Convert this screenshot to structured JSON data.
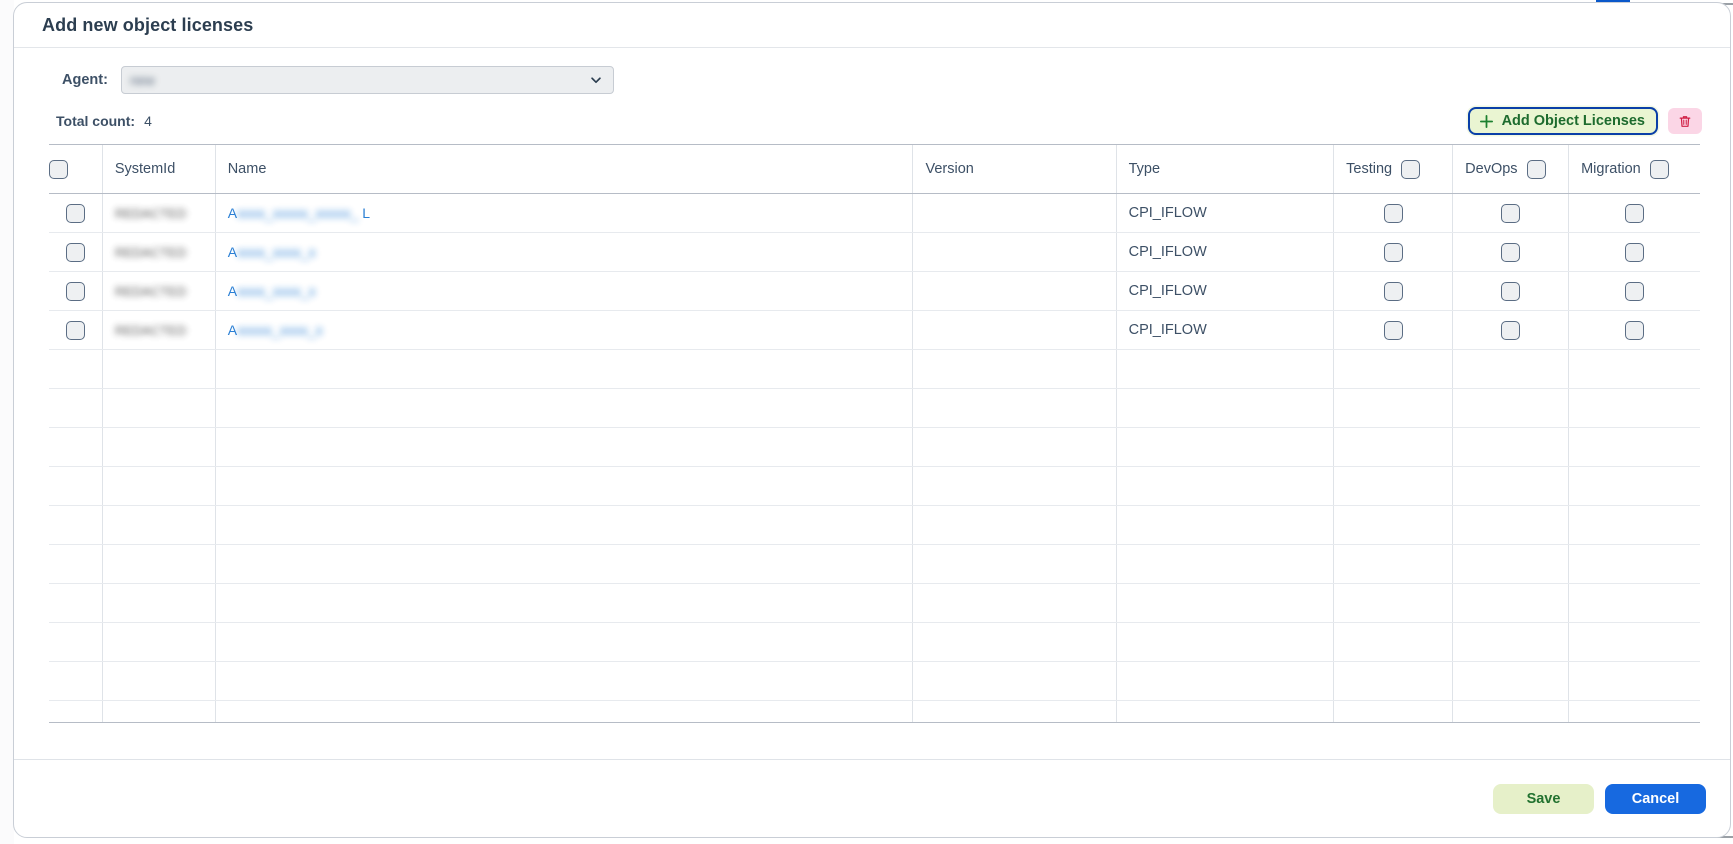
{
  "dialog": {
    "title": "Add new object licenses"
  },
  "agent": {
    "label": "Agent:",
    "selected_value": "new",
    "chevron_icon": "chevron-down-icon"
  },
  "summary": {
    "count_label": "Total count:",
    "count_value": "4"
  },
  "toolbar": {
    "add_label": "Add Object Licenses",
    "add_icon": "plus-icon",
    "delete_icon": "trash-icon",
    "accent_border": "#0a3fa8",
    "add_bg": "#eaf5d2",
    "add_text_color": "#1d6b2e",
    "delete_bg": "#fbd6e6",
    "delete_icon_color": "#d01f45"
  },
  "table": {
    "columns": [
      {
        "key": "select",
        "label": "",
        "has_header_checkbox": true
      },
      {
        "key": "systemId",
        "label": "SystemId",
        "has_header_checkbox": false
      },
      {
        "key": "name",
        "label": "Name",
        "has_header_checkbox": false
      },
      {
        "key": "version",
        "label": "Version",
        "has_header_checkbox": false
      },
      {
        "key": "type",
        "label": "Type",
        "has_header_checkbox": false
      },
      {
        "key": "testing",
        "label": "Testing",
        "has_header_checkbox": true
      },
      {
        "key": "devops",
        "label": "DevOps",
        "has_header_checkbox": true
      },
      {
        "key": "migration",
        "label": "Migration",
        "has_header_checkbox": true
      }
    ],
    "rows": [
      {
        "selected": false,
        "systemId": "REDACTED",
        "name_prefix": "A",
        "name_redacted": "xxxx_xxxxx_xxxxx_",
        "name_suffix": "L",
        "version": "",
        "type": "CPI_IFLOW",
        "testing": false,
        "devops": false,
        "migration": false
      },
      {
        "selected": false,
        "systemId": "REDACTED",
        "name_prefix": "A",
        "name_redacted": "xxxx_xxxx_x",
        "name_suffix": "",
        "version": "",
        "type": "CPI_IFLOW",
        "testing": false,
        "devops": false,
        "migration": false
      },
      {
        "selected": false,
        "systemId": "REDACTED",
        "name_prefix": "A",
        "name_redacted": "xxxx_xxxx_x",
        "name_suffix": "",
        "version": "",
        "type": "CPI_IFLOW",
        "testing": false,
        "devops": false,
        "migration": false
      },
      {
        "selected": false,
        "systemId": "REDACTED",
        "name_prefix": "A",
        "name_redacted": "xxxxx_xxxx_x",
        "name_suffix": "",
        "version": "",
        "type": "CPI_IFLOW",
        "testing": false,
        "devops": false,
        "migration": false
      }
    ],
    "empty_row_count": 12
  },
  "footer": {
    "save_label": "Save",
    "cancel_label": "Cancel",
    "save_bg": "#e6f0c9",
    "save_text_color": "#22722f",
    "cancel_bg": "#1769e0",
    "cancel_text_color": "#ffffff"
  }
}
